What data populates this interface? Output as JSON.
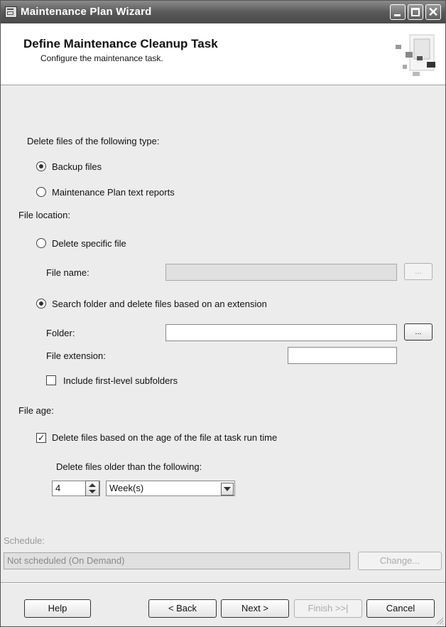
{
  "window": {
    "title": "Maintenance Plan Wizard",
    "close_glyph": "✕"
  },
  "header": {
    "title": "Define Maintenance Cleanup Task",
    "subtitle": "Configure the maintenance task."
  },
  "file_type": {
    "label": "Delete files of the following type:",
    "options": [
      {
        "label": "Backup files",
        "selected": true
      },
      {
        "label": "Maintenance Plan text reports",
        "selected": false
      }
    ]
  },
  "file_location": {
    "label": "File location:",
    "specific_file": {
      "label": "Delete specific file",
      "selected": false
    },
    "file_name": {
      "label": "File name:",
      "value": "",
      "browse_label": "..."
    },
    "search_folder": {
      "label": "Search folder and delete files based on an extension",
      "selected": true
    },
    "folder": {
      "label": "Folder:",
      "value": "",
      "browse_label": "..."
    },
    "extension": {
      "label": "File extension:",
      "value": ""
    },
    "include_subfolders": {
      "label": "Include first-level subfolders",
      "checked": false
    }
  },
  "file_age": {
    "label": "File age:",
    "delete_by_age": {
      "label": "Delete files based on the age of the file at task run time",
      "checked": true
    },
    "older_than_label": "Delete files older than the following:",
    "amount": "4",
    "unit": "Week(s)"
  },
  "schedule": {
    "label": "Schedule:",
    "value": "Not scheduled (On Demand)",
    "change_label": "Change..."
  },
  "buttons": {
    "help": "Help",
    "back": "< Back",
    "next": "Next >",
    "finish": "Finish >>|",
    "cancel": "Cancel"
  },
  "icons": [
    "window-app-icon",
    "minimize-icon",
    "maximize-icon",
    "close-icon",
    "wizard-header-art",
    "spin-up-icon",
    "spin-down-icon",
    "dropdown-arrow-icon",
    "size-grip-icon"
  ]
}
